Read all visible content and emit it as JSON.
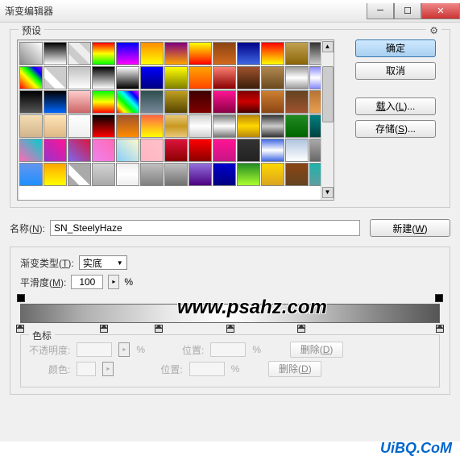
{
  "window": {
    "title": "渐变编辑器"
  },
  "presets": {
    "label": "预设",
    "gear_icon": "⚙"
  },
  "buttons": {
    "ok": "确定",
    "cancel": "取消",
    "load": "载入(L)...",
    "save": "存储(S)...",
    "new": "新建(W)"
  },
  "name": {
    "label": "名称(N):",
    "value": "SN_SteelyHaze"
  },
  "gradient": {
    "type_label": "渐变类型(T):",
    "type_value": "实底",
    "smooth_label": "平滑度(M):",
    "smooth_value": "100",
    "percent": "%"
  },
  "stops": {
    "group_label": "色标",
    "opacity_label": "不透明度:",
    "location_label": "位置:",
    "color_label": "颜色:",
    "delete_label": "删除(D)",
    "percent": "%"
  },
  "watermark": "www.psahz.com",
  "footer": "UiBQ.CoM",
  "swatches": [
    "linear-gradient(45deg,#888,#fff)",
    "linear-gradient(#000,#fff)",
    "linear-gradient(45deg,#eee 25%,#ccc 25%,#ccc 50%,#eee 50%,#eee 75%,#ccc 75%)",
    "linear-gradient(#f00,#ff0,#0f0)",
    "linear-gradient(#00f,#f0f)",
    "linear-gradient(#ff8c00,#ff0)",
    "linear-gradient(#800080,#ffa500)",
    "linear-gradient(#ff0,#f00)",
    "linear-gradient(#8b4513,#d2691e)",
    "linear-gradient(#00008b,#4169e1)",
    "linear-gradient(#f00,#ff0)",
    "linear-gradient(#c0a050,#8b6508)",
    "linear-gradient(#333,#ccc)",
    "linear-gradient(45deg,#f00,#ff7f00,#ff0,#0f0,#00f,#8b00ff)",
    "linear-gradient(45deg,#ccc 25%,#fff 25%,#fff 50%,#ccc 50%)",
    "linear-gradient(#c0c0c0,#fff)",
    "linear-gradient(#000,#fff)",
    "linear-gradient(#fff,#000)",
    "linear-gradient(#00f,#000080)",
    "linear-gradient(#ff0,#808000)",
    "linear-gradient(#ffa500,#ff4500)",
    "linear-gradient(#fa8072,#8b0000)",
    "linear-gradient(#a0522d,#3a1f0b)",
    "linear-gradient(#b08850,#6b4a20)",
    "linear-gradient(#999,#fff,#999)",
    "linear-gradient(#8888ff,#fff,#8888ff)",
    "linear-gradient(#000,#555)",
    "linear-gradient(#000,#0066ff)",
    "linear-gradient(#ffcccc,#cc6666)",
    "linear-gradient(#0f0,#ff0,#f00)",
    "linear-gradient(45deg,#f00,#ff0,#0f0,#0ff,#00f,#f0f)",
    "linear-gradient(#2f4f4f,#778899)",
    "linear-gradient(#c0a020,#554400)",
    "linear-gradient(#400000,#800000)",
    "linear-gradient(#ff1493,#8b0045)",
    "linear-gradient(#800000,#c00,#400)",
    "linear-gradient(#cd7f32,#8b4513)",
    "linear-gradient(#654321,#a0522d)",
    "linear-gradient(#b87333,#e8a050)",
    "linear-gradient(#f5deb3,#d2b48c)",
    "linear-gradient(#ffe4b5,#deb887)",
    "linear-gradient(#fff,#eee)",
    "linear-gradient(#000,#f00)",
    "linear-gradient(#a0522d,#ff8c00)",
    "linear-gradient(#ff6347,#ff0)",
    "linear-gradient(#e8c878,#c89820,#e8c878)",
    "linear-gradient(#d0d0d0,#fff,#d0d0d0)",
    "linear-gradient(#777,#fff,#777)",
    "linear-gradient(#b8860b,#ffd700,#b8860b)",
    "linear-gradient(#333,#ccc,#333)",
    "linear-gradient(#228b22,#006400)",
    "linear-gradient(#008080,#004040)",
    "linear-gradient(45deg,#ff69b4,#00ced1)",
    "linear-gradient(45deg,#9932cc,#ff1493)",
    "linear-gradient(45deg,#7b68ee,#dc143c)",
    "linear-gradient(45deg,#ee82ee,#ff69b4)",
    "linear-gradient(45deg,#87cefa,#fffacd)",
    "linear-gradient(45deg,#ffb6c1,#ffc0cb)",
    "linear-gradient(#dc143c,#8b0000)",
    "linear-gradient(#f00,#8b0000)",
    "linear-gradient(#ff1493,#c71585)",
    "linear-gradient(#333,#222)",
    "linear-gradient(#4169e1,#fff,#4169e1)",
    "linear-gradient(#b0c4de,#fff)",
    "linear-gradient(#a9a9a9,#696969)",
    "linear-gradient(#6495ed,#1e90ff)",
    "linear-gradient(#ffa500,#ff0)",
    "linear-gradient(45deg,#aaa 25%,#fff 25%,#fff 50%,#aaa 50%)",
    "linear-gradient(#d3d3d3,#a9a9a9)",
    "linear-gradient(#eee,#fff,#eee)",
    "linear-gradient(#c0c0c0,#808080)",
    "linear-gradient(#c0c0c0,#707070)",
    "linear-gradient(#9370db,#4b0082)",
    "linear-gradient(#0000cd,#000080)",
    "linear-gradient(#228b22,#adff2f)",
    "linear-gradient(#ffd700,#daa520)",
    "linear-gradient(#8b4513,#654321)",
    "linear-gradient(#20b2aa,#5f9ea0)"
  ],
  "color_stops_positions": [
    0,
    20,
    33,
    50,
    67,
    100
  ]
}
